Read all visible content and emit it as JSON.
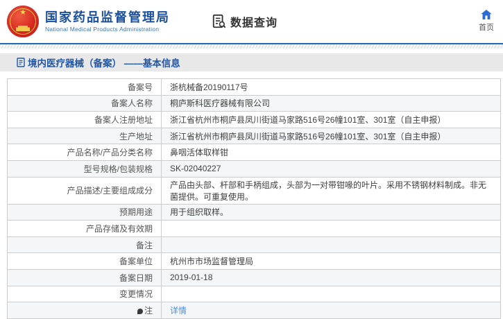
{
  "header": {
    "brand_title": "国家药品监督管理局",
    "brand_subtitle": "National Medical Products Administration",
    "nav_query_label": "数据查询",
    "home_label": "首页"
  },
  "section": {
    "title": "境内医疗器械（备案） ——基本信息"
  },
  "table": {
    "rows": [
      {
        "label": "备案号",
        "value": "浙杭械备20190117号"
      },
      {
        "label": "备案人名称",
        "value": "桐庐斯科医疗器械有限公司"
      },
      {
        "label": "备案人注册地址",
        "value": "浙江省杭州市桐庐县凤川街道马家路516号26幢101室、301室（自主申报）"
      },
      {
        "label": "生产地址",
        "value": "浙江省杭州市桐庐县凤川街道马家路516号26幢101室、301室（自主申报）"
      },
      {
        "label": "产品名称/产品分类名称",
        "value": "鼻咽活体取样钳"
      },
      {
        "label": "型号规格/包装规格",
        "value": "SK-02040227"
      },
      {
        "label": "产品描述/主要组成成分",
        "value": "产品由头部、杆部和手柄组成，头部为一对带钳喙的叶片。采用不锈钢材料制成。非无菌提供。可重复使用。"
      },
      {
        "label": "预期用途",
        "value": "用于组织取样。"
      },
      {
        "label": "产品存储及有效期",
        "value": ""
      },
      {
        "label": "备注",
        "value": ""
      },
      {
        "label": "备案单位",
        "value": "杭州市市场监督管理局"
      },
      {
        "label": "备案日期",
        "value": "2019-01-18"
      },
      {
        "label": "变更情况",
        "value": ""
      },
      {
        "label": "注",
        "value": "详情",
        "value_is_link": true,
        "label_icon": "note-dot-icon"
      }
    ]
  },
  "colors": {
    "brand_blue": "#1a4f9e",
    "section_blue": "#2056a8",
    "rule_blue": "#1f6bb0",
    "link_blue": "#4a90d9",
    "home_blue": "#2b6bd3",
    "row_alt_gray": "#f5f6f7",
    "bar_gray": "#e8e8e8",
    "border_gray": "#cccccc",
    "emblem_red": "#d6281e",
    "emblem_gold": "#f2c94c"
  }
}
